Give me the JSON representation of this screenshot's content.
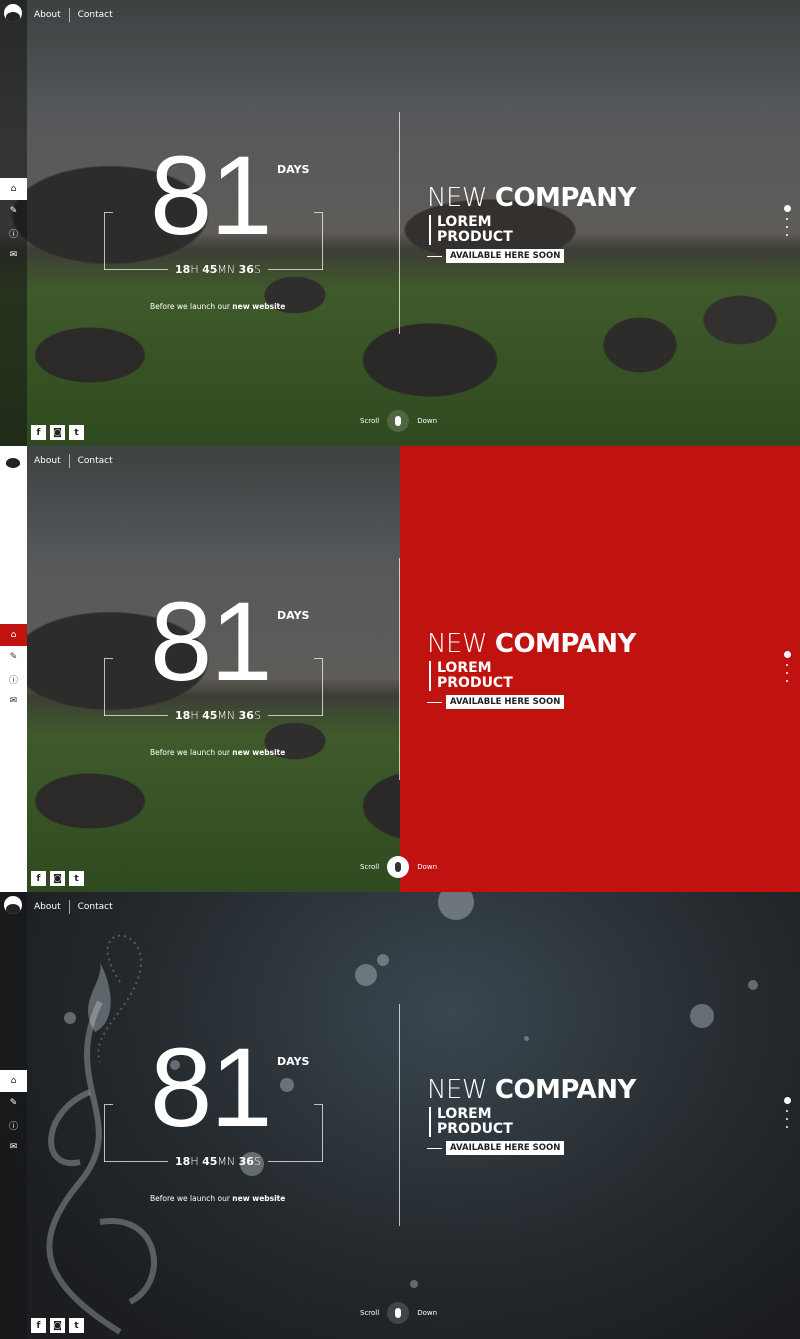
{
  "nav": {
    "about": "About",
    "contact": "Contact"
  },
  "sidebar_icons": [
    "home-icon",
    "edit-icon",
    "info-icon",
    "mail-icon"
  ],
  "social": {
    "facebook": "f",
    "instagram": "◙",
    "twitter": "t"
  },
  "countdown": {
    "days": "81",
    "days_label": "DAYS",
    "hours": "18",
    "hours_unit": "H",
    "minutes": "45",
    "minutes_unit": "MN",
    "seconds": "36",
    "seconds_unit": "S"
  },
  "tagline": {
    "prefix": "Before we launch our ",
    "highlight": "new website"
  },
  "headline": {
    "light": "NEW ",
    "bold": "COMPANY",
    "product_line1": "LOREM",
    "product_line2": "PRODUCT",
    "badge": "AVAILABLE HERE SOON"
  },
  "scroll": {
    "left": "Scroll",
    "right": "Down"
  },
  "colors": {
    "accent_red": "#c0120f",
    "dark_bg": "#1b1d20"
  },
  "panels": [
    {
      "variant": "landscape-photo"
    },
    {
      "variant": "landscape-photo-red-split"
    },
    {
      "variant": "dark-bokeh"
    }
  ]
}
